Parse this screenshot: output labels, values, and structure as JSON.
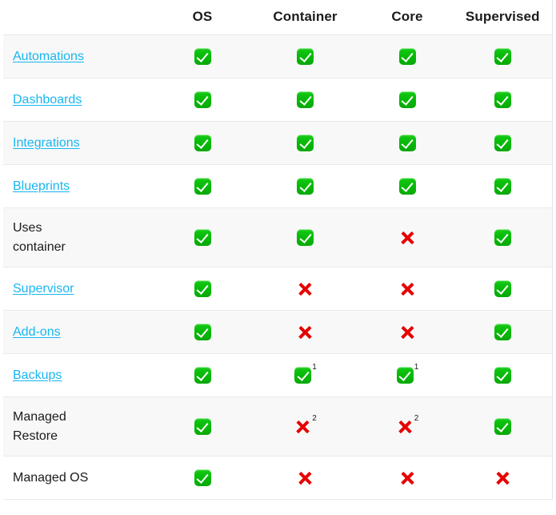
{
  "table": {
    "columns": [
      {
        "key": "feature",
        "label": "",
        "type": "feature"
      },
      {
        "key": "os",
        "label": "OS",
        "type": "value"
      },
      {
        "key": "container",
        "label": "Container",
        "type": "value"
      },
      {
        "key": "core",
        "label": "Core",
        "type": "value"
      },
      {
        "key": "supervised",
        "label": "Supervised",
        "type": "value"
      }
    ],
    "rows": [
      {
        "feature": "Automations",
        "is_link": true,
        "wraps": false,
        "cells": [
          {
            "mark": "check",
            "note": ""
          },
          {
            "mark": "check",
            "note": ""
          },
          {
            "mark": "check",
            "note": ""
          },
          {
            "mark": "check",
            "note": ""
          }
        ]
      },
      {
        "feature": "Dashboards",
        "is_link": true,
        "wraps": false,
        "cells": [
          {
            "mark": "check",
            "note": ""
          },
          {
            "mark": "check",
            "note": ""
          },
          {
            "mark": "check",
            "note": ""
          },
          {
            "mark": "check",
            "note": ""
          }
        ]
      },
      {
        "feature": "Integrations",
        "is_link": true,
        "wraps": false,
        "cells": [
          {
            "mark": "check",
            "note": ""
          },
          {
            "mark": "check",
            "note": ""
          },
          {
            "mark": "check",
            "note": ""
          },
          {
            "mark": "check",
            "note": ""
          }
        ]
      },
      {
        "feature": "Blueprints",
        "is_link": true,
        "wraps": false,
        "cells": [
          {
            "mark": "check",
            "note": ""
          },
          {
            "mark": "check",
            "note": ""
          },
          {
            "mark": "check",
            "note": ""
          },
          {
            "mark": "check",
            "note": ""
          }
        ]
      },
      {
        "feature": "Uses container",
        "feature_line1": "Uses",
        "feature_line2": "container",
        "is_link": false,
        "wraps": true,
        "cells": [
          {
            "mark": "check",
            "note": ""
          },
          {
            "mark": "check",
            "note": ""
          },
          {
            "mark": "cross",
            "note": ""
          },
          {
            "mark": "check",
            "note": ""
          }
        ]
      },
      {
        "feature": "Supervisor",
        "is_link": true,
        "wraps": false,
        "cells": [
          {
            "mark": "check",
            "note": ""
          },
          {
            "mark": "cross",
            "note": ""
          },
          {
            "mark": "cross",
            "note": ""
          },
          {
            "mark": "check",
            "note": ""
          }
        ]
      },
      {
        "feature": "Add-ons",
        "is_link": true,
        "wraps": false,
        "cells": [
          {
            "mark": "check",
            "note": ""
          },
          {
            "mark": "cross",
            "note": ""
          },
          {
            "mark": "cross",
            "note": ""
          },
          {
            "mark": "check",
            "note": ""
          }
        ]
      },
      {
        "feature": "Backups",
        "is_link": true,
        "wraps": false,
        "cells": [
          {
            "mark": "check",
            "note": ""
          },
          {
            "mark": "check",
            "note": "1"
          },
          {
            "mark": "check",
            "note": "1"
          },
          {
            "mark": "check",
            "note": ""
          }
        ]
      },
      {
        "feature": "Managed Restore",
        "feature_line1": "Managed",
        "feature_line2": "Restore",
        "is_link": false,
        "wraps": true,
        "cells": [
          {
            "mark": "check",
            "note": ""
          },
          {
            "mark": "cross",
            "note": "2"
          },
          {
            "mark": "cross",
            "note": "2"
          },
          {
            "mark": "check",
            "note": ""
          }
        ]
      },
      {
        "feature": "Managed OS",
        "is_link": false,
        "wraps": false,
        "cells": [
          {
            "mark": "check",
            "note": ""
          },
          {
            "mark": "cross",
            "note": ""
          },
          {
            "mark": "cross",
            "note": ""
          },
          {
            "mark": "cross",
            "note": ""
          }
        ]
      }
    ]
  },
  "icons": {
    "check": "check-mark-button-icon",
    "cross": "cross-mark-icon"
  },
  "colors": {
    "link": "#18b6f0",
    "check_green": "#06b806",
    "cross_red": "#e60000",
    "row_stripe": "#f8f8f8",
    "row_base": "#ffffff",
    "border": "#eaeaea",
    "text": "#1b1b1b"
  }
}
